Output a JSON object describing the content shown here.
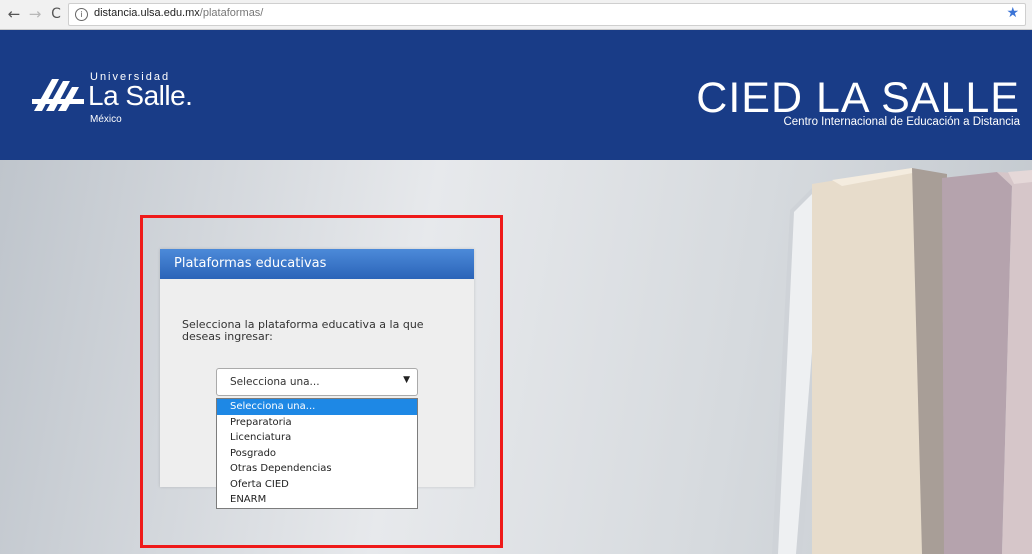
{
  "browser": {
    "url_host": "distancia.ulsa.edu.mx",
    "url_path": "/plataformas/",
    "back_icon": "←",
    "forward_icon": "→",
    "reload_icon": "C",
    "info_icon": "i",
    "star_icon": "★"
  },
  "header": {
    "logo_small": "Universidad",
    "logo_big": "La Salle.",
    "logo_place": "México",
    "title": "CIED LA SALLE",
    "subtitle": "Centro Internacional de Educación a Distancia",
    "bg_color": "#193c87"
  },
  "panel": {
    "title": "Plataformas educativas",
    "instruction": "Selecciona la plataforma educativa a la que deseas ingresar:",
    "select_value": "Selecciona una...",
    "caret": "▼",
    "options": [
      "Selecciona una...",
      "Preparatoria",
      "Licenciatura",
      "Posgrado",
      "Otras Dependencias",
      "Oferta CIED",
      "ENARM"
    ],
    "selected_index": 0,
    "highlight_color": "#1e88e5"
  },
  "annotation": {
    "color": "#ef1a1a"
  }
}
